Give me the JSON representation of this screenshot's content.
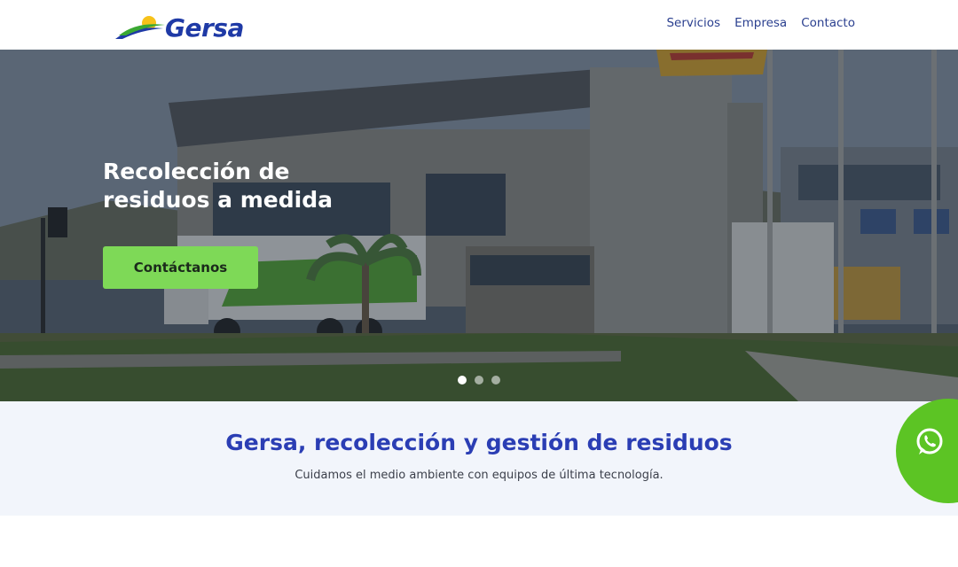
{
  "header": {
    "logo_text": "Gersa",
    "nav": [
      {
        "label": "Servicios"
      },
      {
        "label": "Empresa"
      },
      {
        "label": "Contacto"
      }
    ]
  },
  "hero": {
    "title": "Recolección de\nresiduos a medida",
    "cta_label": "Contáctanos",
    "slides": 3,
    "active_slide": 1
  },
  "intro": {
    "title": "Gersa, recolección y gestión de residuos",
    "subtitle": "Cuidamos el medio ambiente con equipos de última tecnología."
  },
  "floating": {
    "icon": "whatsapp-icon"
  },
  "colors": {
    "brand_blue": "#2b3eb4",
    "accent_green": "#7ed957",
    "whatsapp_green": "#5cc424",
    "nav_text": "#2a3f8f"
  }
}
